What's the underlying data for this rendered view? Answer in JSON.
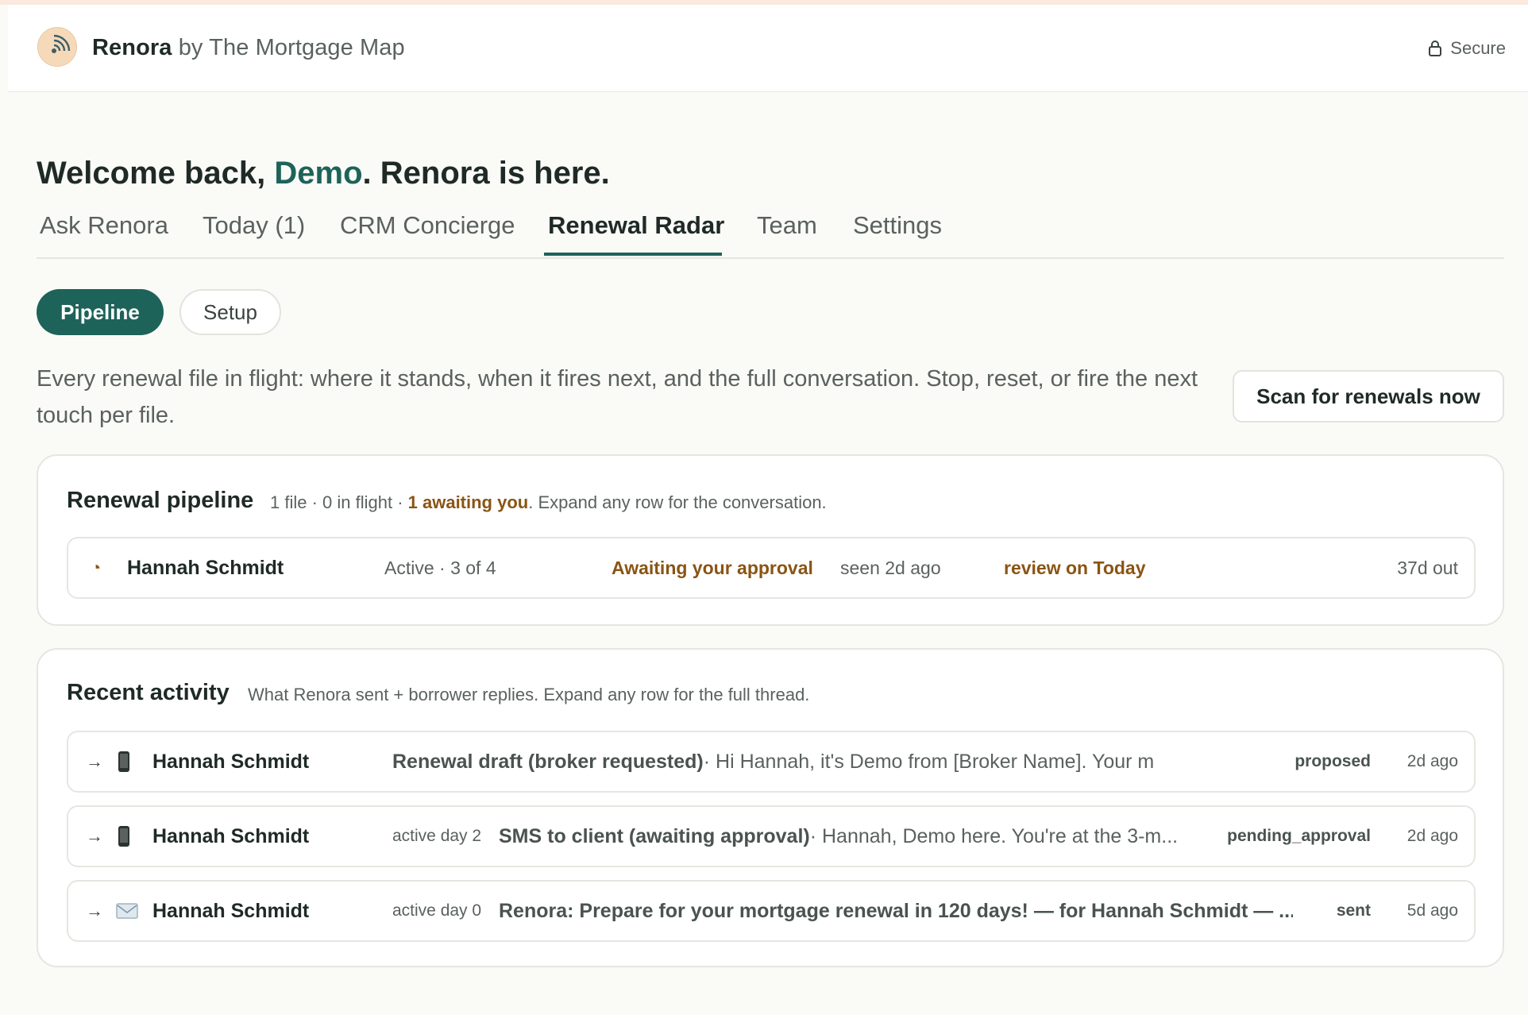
{
  "header": {
    "brand_name": "Renora",
    "brand_by": "by The Mortgage Map",
    "secure_label": "Secure"
  },
  "welcome": {
    "prefix": "Welcome back, ",
    "user": "Demo",
    "suffix": ". Renora is here."
  },
  "tabs": [
    {
      "label": "Ask Renora"
    },
    {
      "label": "Today (1)"
    },
    {
      "label": "CRM Concierge"
    },
    {
      "label": "Renewal Radar",
      "active": true
    },
    {
      "label": "Team"
    },
    {
      "label": "Settings"
    }
  ],
  "subtabs": {
    "pipeline": "Pipeline",
    "setup": "Setup"
  },
  "description": "Every renewal file in flight: where it stands, when it fires next, and the full conversation. Stop, reset, or fire the next touch per file.",
  "scan_button": "Scan for renewals now",
  "pipeline": {
    "title": "Renewal pipeline",
    "summary_prefix": "1 file · 0 in flight · ",
    "summary_highlight": "1 awaiting you",
    "summary_suffix": ". Expand any row for the conversation.",
    "rows": [
      {
        "icon": "◔",
        "name": "Hannah Schmidt",
        "stage": "Active · 3 of 4",
        "status": "Awaiting your approval",
        "seen": "seen 2d ago",
        "next": "review on Today",
        "due": "37d out"
      }
    ]
  },
  "activity": {
    "title": "Recent activity",
    "subtitle": "What Renora sent + borrower replies. Expand any row for the full thread.",
    "rows": [
      {
        "arrow": "→",
        "channel_icon": "phone-icon",
        "name": "Hannah Schmidt",
        "day": "",
        "subject": "Renewal draft (broker requested)",
        "preview": " · Hi Hannah, it's Demo from [Broker Name]. Your mortgage...",
        "status": "proposed",
        "age": "2d ago"
      },
      {
        "arrow": "→",
        "channel_icon": "phone-icon",
        "name": "Hannah Schmidt",
        "day": "active day 2",
        "subject": "SMS to client (awaiting approval)",
        "preview": " · Hannah, Demo here. You're at the 3-m...",
        "status": "pending_approval",
        "age": "2d ago"
      },
      {
        "arrow": "→",
        "channel_icon": "email-icon",
        "name": "Hannah Schmidt",
        "day": "active day 0",
        "subject": "Renora: Prepare for your mortgage renewal in 120 days! — for Hannah Schmidt — ...",
        "preview": "",
        "status": "sent",
        "age": "5d ago"
      }
    ]
  }
}
